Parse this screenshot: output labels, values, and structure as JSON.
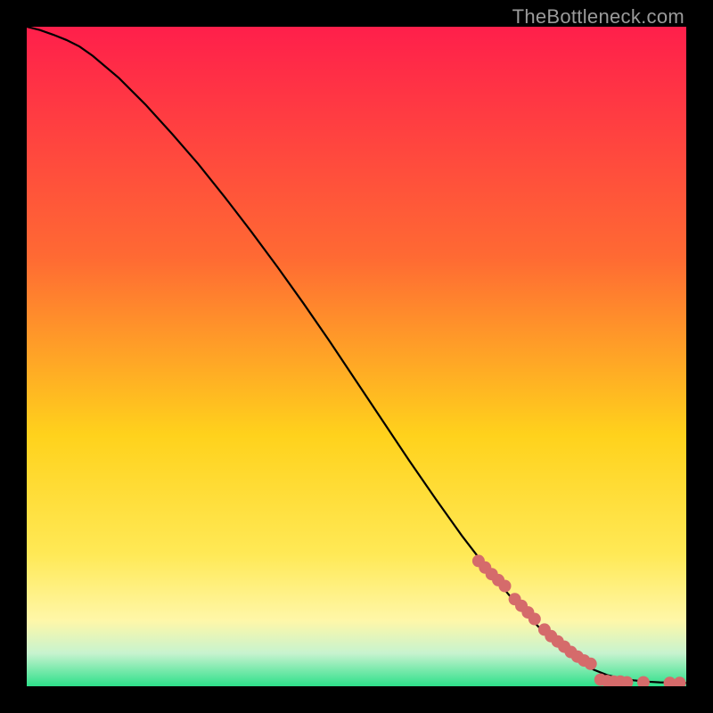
{
  "watermark": "TheBottleneck.com",
  "colors": {
    "top": "#ff1f4b",
    "upper_mid": "#ff6a33",
    "mid": "#ffd21c",
    "lower_mid": "#ffe956",
    "pale_yellow": "#fff7a8",
    "pale_green": "#c7f3cf",
    "green": "#2ee08a",
    "marker": "#d56b6b",
    "curve": "#000000",
    "bg": "#000000"
  },
  "chart_data": {
    "type": "line",
    "title": "",
    "xlabel": "",
    "ylabel": "",
    "xlim": [
      0,
      100
    ],
    "ylim": [
      0,
      100
    ],
    "series": [
      {
        "name": "curve",
        "x": [
          0,
          2,
          4,
          6,
          8,
          10,
          14,
          18,
          22,
          26,
          30,
          34,
          38,
          42,
          46,
          50,
          54,
          58,
          62,
          66,
          70,
          74,
          78,
          82,
          84,
          86,
          88,
          90,
          92,
          94,
          96,
          98,
          100
        ],
        "y": [
          100,
          99.5,
          98.8,
          98.0,
          97.0,
          95.6,
          92.2,
          88.2,
          83.8,
          79.2,
          74.2,
          69.0,
          63.6,
          58.0,
          52.2,
          46.2,
          40.2,
          34.2,
          28.4,
          22.8,
          17.6,
          12.8,
          8.6,
          5.0,
          3.6,
          2.5,
          1.7,
          1.2,
          0.9,
          0.7,
          0.6,
          0.55,
          0.5
        ]
      }
    ],
    "markers": {
      "name": "highlight-points",
      "color": "#d56b6b",
      "radius_px": 7,
      "points": [
        {
          "x": 68.5,
          "y": 19.0
        },
        {
          "x": 69.5,
          "y": 18.0
        },
        {
          "x": 70.5,
          "y": 17.0
        },
        {
          "x": 71.5,
          "y": 16.1
        },
        {
          "x": 72.5,
          "y": 15.2
        },
        {
          "x": 74.0,
          "y": 13.2
        },
        {
          "x": 75.0,
          "y": 12.2
        },
        {
          "x": 76.0,
          "y": 11.2
        },
        {
          "x": 77.0,
          "y": 10.2
        },
        {
          "x": 78.5,
          "y": 8.6
        },
        {
          "x": 79.5,
          "y": 7.6
        },
        {
          "x": 80.5,
          "y": 6.8
        },
        {
          "x": 81.5,
          "y": 6.0
        },
        {
          "x": 82.5,
          "y": 5.2
        },
        {
          "x": 83.5,
          "y": 4.5
        },
        {
          "x": 84.5,
          "y": 3.9
        },
        {
          "x": 85.5,
          "y": 3.4
        },
        {
          "x": 87.0,
          "y": 1.0
        },
        {
          "x": 88.0,
          "y": 0.8
        },
        {
          "x": 89.0,
          "y": 0.7
        },
        {
          "x": 90.0,
          "y": 0.7
        },
        {
          "x": 91.0,
          "y": 0.6
        },
        {
          "x": 93.5,
          "y": 0.6
        },
        {
          "x": 97.5,
          "y": 0.5
        },
        {
          "x": 99.0,
          "y": 0.5
        }
      ]
    }
  }
}
